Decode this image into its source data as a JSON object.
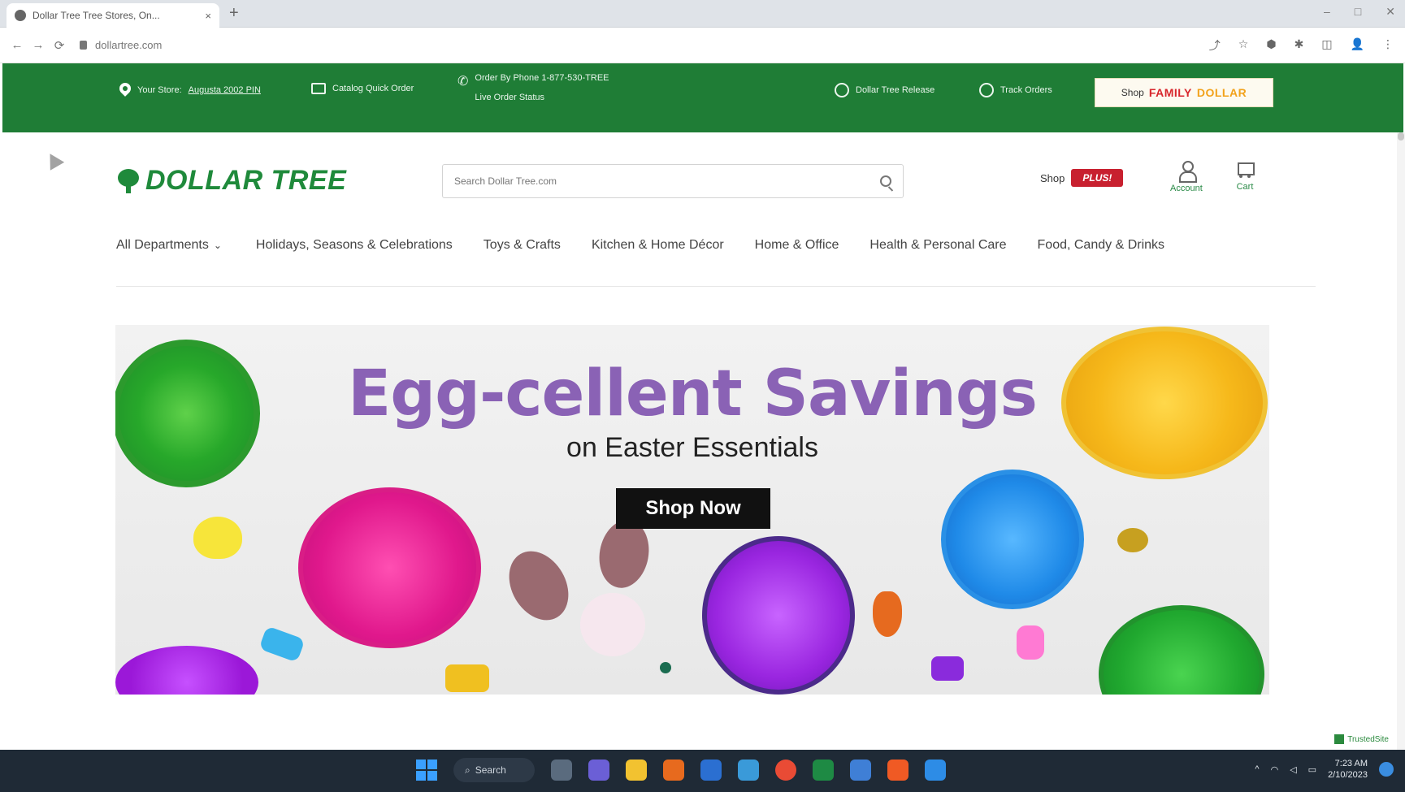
{
  "browser": {
    "tab_title": "Dollar Tree Tree Stores, On...",
    "tab_close": "×",
    "new_tab": "+",
    "url": "dollartree.com",
    "nav": {
      "back": "←",
      "forward": "→",
      "reload": "⟳"
    },
    "window_controls": {
      "minimize": "–",
      "maximize": "□",
      "close": "✕"
    },
    "toolbar_icons": [
      "⤴",
      "☆",
      "⬢",
      "✱",
      "◫",
      "👤",
      "⋮"
    ]
  },
  "utility_bar": {
    "store_label": "Your Store:",
    "store_name": "Augusta 2002 PIN",
    "catalog": "Catalog Quick Order",
    "phone_line1": "Order By Phone 1-877-530-TREE",
    "phone_line2": "Live Order Status",
    "reload_label": "Dollar Tree Release",
    "track_order": "Track Orders",
    "shop_family_prefix": "Shop",
    "shop_family_brand1": "FAMILY",
    "shop_family_brand2": "DOLLAR"
  },
  "header": {
    "logo_text": "DOLLAR TREE",
    "search_placeholder": "Search Dollar Tree.com",
    "shop_label": "Shop",
    "plus_label": "PLUS!",
    "account_label": "Account",
    "cart_label": "Cart"
  },
  "categories": [
    "All Departments",
    "Holidays, Seasons & Celebrations",
    "Toys & Crafts",
    "Kitchen & Home Décor",
    "Home & Office",
    "Health & Personal Care",
    "Food, Candy & Drinks"
  ],
  "hero": {
    "title": "Egg-cellent Savings",
    "subtitle": "on Easter Essentials",
    "cta": "Shop Now"
  },
  "trusted_badge": "TrustedSite",
  "taskbar": {
    "search_label": "Search",
    "time": "7:23 AM",
    "date": "2/10/2023"
  },
  "colors": {
    "brand_green": "#1f7d36",
    "logo_green": "#1f8a3b",
    "hero_title": "#8a62b5",
    "plus_red": "#c8202f"
  }
}
